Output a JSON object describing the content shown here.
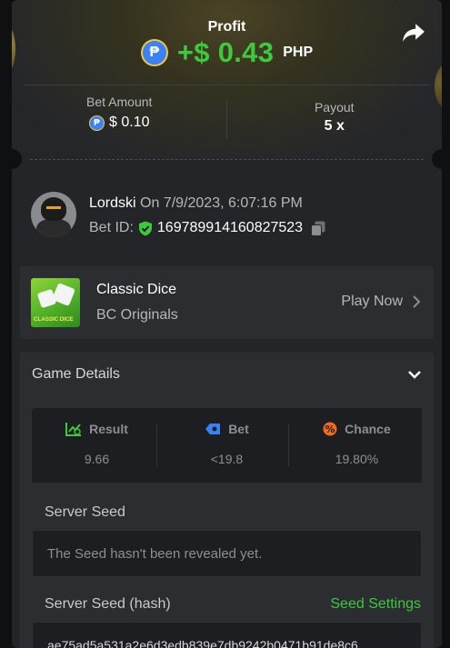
{
  "hero": {
    "profit_label": "Profit",
    "coin_symbol": "₱",
    "profit_amount": "+$ 0.43",
    "profit_currency": "PHP"
  },
  "bet": {
    "amount_label": "Bet Amount",
    "amount_value": "$ 0.10",
    "payout_label": "Payout",
    "payout_value": "5 x"
  },
  "user": {
    "name": "Lordski",
    "date": "On 7/9/2023, 6:07:16 PM",
    "bet_id_label": "Bet ID:",
    "bet_id": "169789914160827523"
  },
  "game": {
    "title": "Classic Dice",
    "provider": "BC Originals",
    "thumb_text": "CLASSIC DICE",
    "play_label": "Play Now"
  },
  "details": {
    "title": "Game Details",
    "stats": [
      {
        "label": "Result",
        "value": "9.66",
        "icon": "result-icon",
        "color": "#3cc93c"
      },
      {
        "label": "Bet",
        "value": "<19.8",
        "icon": "bet-icon",
        "color": "#3b82f6"
      },
      {
        "label": "Chance",
        "value": "19.80%",
        "icon": "chance-icon",
        "color": "#f26a1b"
      }
    ],
    "server_seed_label": "Server Seed",
    "server_seed_value": "The Seed hasn't been revealed yet.",
    "server_seed_hash_label": "Server Seed (hash)",
    "seed_settings_label": "Seed Settings",
    "server_seed_hash": "ae75ad5a531a2e6d3edb839e7db9242b0471b91de8c6"
  },
  "colors": {
    "profit_green": "#3cc93c",
    "background": "#232529",
    "panel": "#2b2d31"
  }
}
